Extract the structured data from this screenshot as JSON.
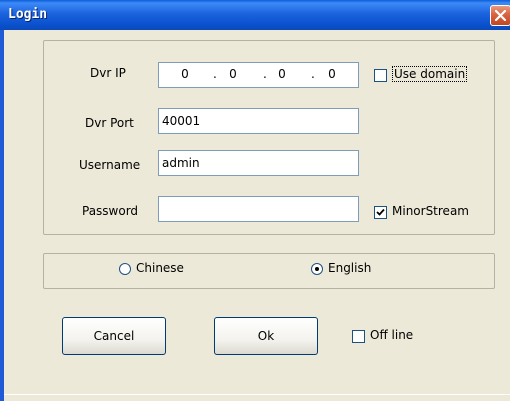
{
  "window": {
    "title": "Login"
  },
  "form": {
    "dvr_ip_label": "Dvr IP",
    "ip_segments": [
      "0",
      "0",
      "0",
      "0"
    ],
    "ip_separator": ".",
    "use_domain_label": "Use domain",
    "use_domain_checked": false,
    "dvr_port_label": "Dvr Port",
    "dvr_port_value": "40001",
    "username_label": "Username",
    "username_value": "admin",
    "password_label": "Password",
    "password_value": "",
    "minorstream_label": "MinorStream",
    "minorstream_checked": true
  },
  "language": {
    "chinese_label": "Chinese",
    "english_label": "English",
    "selected": "English"
  },
  "buttons": {
    "cancel_label": "Cancel",
    "ok_label": "Ok"
  },
  "offline": {
    "label": "Off line",
    "checked": false
  },
  "icons": {
    "close": "close-icon",
    "check": "checkmark-icon"
  },
  "colors": {
    "titlebar": "#0a52cf",
    "close_button": "#d9623f",
    "dialog_background": "#ece9d8",
    "field_border": "#7f9db9"
  }
}
